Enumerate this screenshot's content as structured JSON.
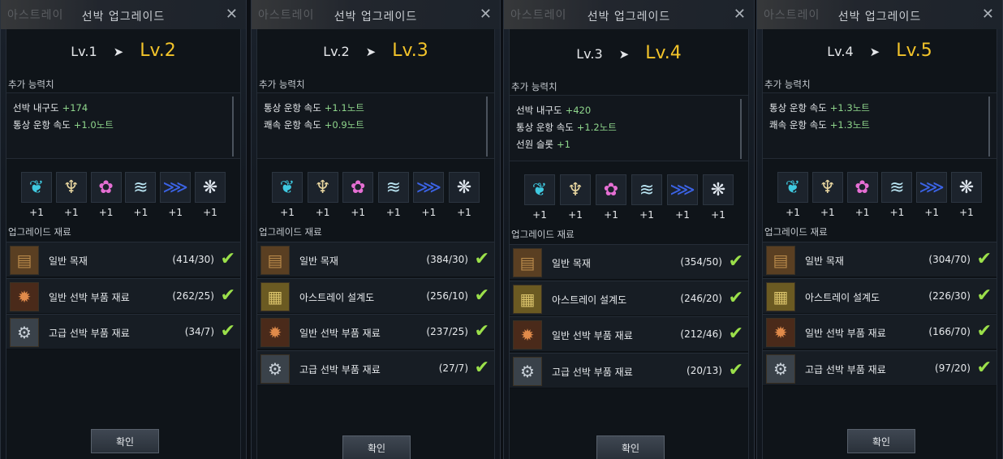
{
  "panels": [
    {
      "ghost": "아스트레이",
      "title": "선박 업그레이드",
      "close": "✕",
      "lv_from": "Lv.1",
      "lv_to": "Lv.2",
      "extra_label": "추가 능력치",
      "stats": [
        {
          "name": "선박 내구도",
          "value": "+174"
        },
        {
          "name": "통상 운항 속도",
          "value": "+1.0노트"
        }
      ],
      "icon_bonus": [
        "+1",
        "+1",
        "+1",
        "+1",
        "+1",
        "+1"
      ],
      "materials_label": "업그레이드 재료",
      "materials": [
        {
          "name": "일반 목재",
          "count": "(414/30)"
        },
        {
          "name": "일반 선박 부품 재료",
          "count": "(262/25)"
        },
        {
          "name": "고급 선박 부품 재료",
          "count": "(34/7)"
        }
      ],
      "confirm": "확인"
    },
    {
      "ghost": "아스트레이",
      "title": "선박 업그레이드",
      "close": "✕",
      "lv_from": "Lv.2",
      "lv_to": "Lv.3",
      "extra_label": "추가 능력치",
      "stats": [
        {
          "name": "통상 운항 속도",
          "value": "+1.1노트"
        },
        {
          "name": "쾌속 운항 속도",
          "value": "+0.9노트"
        }
      ],
      "icon_bonus": [
        "+1",
        "+1",
        "+1",
        "+1",
        "+1",
        "+1"
      ],
      "materials_label": "업그레이드 재료",
      "materials": [
        {
          "name": "일반 목재",
          "count": "(384/30)"
        },
        {
          "name": "아스트레이 설계도",
          "count": "(256/10)"
        },
        {
          "name": "일반 선박 부품 재료",
          "count": "(237/25)"
        },
        {
          "name": "고급 선박 부품 재료",
          "count": "(27/7)"
        }
      ],
      "confirm": "확인"
    },
    {
      "ghost": "아스트레이",
      "title": "선박 업그레이드",
      "close": "✕",
      "lv_from": "Lv.3",
      "lv_to": "Lv.4",
      "extra_label": "추가 능력치",
      "stats": [
        {
          "name": "선박 내구도",
          "value": "+420"
        },
        {
          "name": "통상 운항 속도",
          "value": "+1.2노트"
        },
        {
          "name": "선원 슬롯",
          "value": "+1"
        }
      ],
      "icon_bonus": [
        "+1",
        "+1",
        "+1",
        "+1",
        "+1",
        "+1"
      ],
      "materials_label": "업그레이드 재료",
      "materials": [
        {
          "name": "일반 목재",
          "count": "(354/50)"
        },
        {
          "name": "아스트레이 설계도",
          "count": "(246/20)"
        },
        {
          "name": "일반 선박 부품 재료",
          "count": "(212/46)"
        },
        {
          "name": "고급 선박 부품 재료",
          "count": "(20/13)"
        }
      ],
      "confirm": "확인"
    },
    {
      "ghost": "아스트레이",
      "title": "선박 업그레이드",
      "close": "✕",
      "lv_from": "Lv.4",
      "lv_to": "Lv.5",
      "extra_label": "추가 능력치",
      "stats": [
        {
          "name": "통상 운항 속도",
          "value": "+1.3노트"
        },
        {
          "name": "쾌속 운항 속도",
          "value": "+1.3노트"
        }
      ],
      "icon_bonus": [
        "+1",
        "+1",
        "+1",
        "+1",
        "+1",
        "+1"
      ],
      "materials_label": "업그레이드 재료",
      "materials": [
        {
          "name": "일반 목재",
          "count": "(304/70)"
        },
        {
          "name": "아스트레이 설계도",
          "count": "(226/30)"
        },
        {
          "name": "일반 선박 부품 재료",
          "count": "(166/70)"
        },
        {
          "name": "고급 선박 부품 재료",
          "count": "(97/20)"
        }
      ],
      "confirm": "확인"
    }
  ],
  "stat_icons": [
    {
      "name": "sea-spirit-icon",
      "color": "#3fc9e0",
      "glyph": "❦"
    },
    {
      "name": "whirlwind-icon",
      "color": "#e8d6a0",
      "glyph": "♆"
    },
    {
      "name": "pink-fish-icon",
      "color": "#e66fd4",
      "glyph": "✿"
    },
    {
      "name": "wave-icon",
      "color": "#b9e4f2",
      "glyph": "≋"
    },
    {
      "name": "tide-icon",
      "color": "#3b63e6",
      "glyph": "⋙"
    },
    {
      "name": "eagle-icon",
      "color": "#dfe6ee",
      "glyph": "❋"
    }
  ],
  "material_icons": {
    "일반 목재": {
      "name": "wood-icon",
      "color": "#b8894a",
      "bg": "#5a3f22",
      "glyph": "▤"
    },
    "아스트레이 설계도": {
      "name": "blueprint-icon",
      "color": "#d9c26a",
      "bg": "#6b5a22",
      "glyph": "▦"
    },
    "일반 선박 부품 재료": {
      "name": "ship-part-icon",
      "color": "#e08a4a",
      "bg": "#4a2a1a",
      "glyph": "✹"
    },
    "고급 선박 부품 재료": {
      "name": "advanced-part-icon",
      "color": "#c8d0d8",
      "bg": "#3a424a",
      "glyph": "⚙"
    }
  },
  "colors": {
    "level_accent": "#f3c42a",
    "stat_value": "#8fd68c",
    "check": "#9be04a"
  }
}
